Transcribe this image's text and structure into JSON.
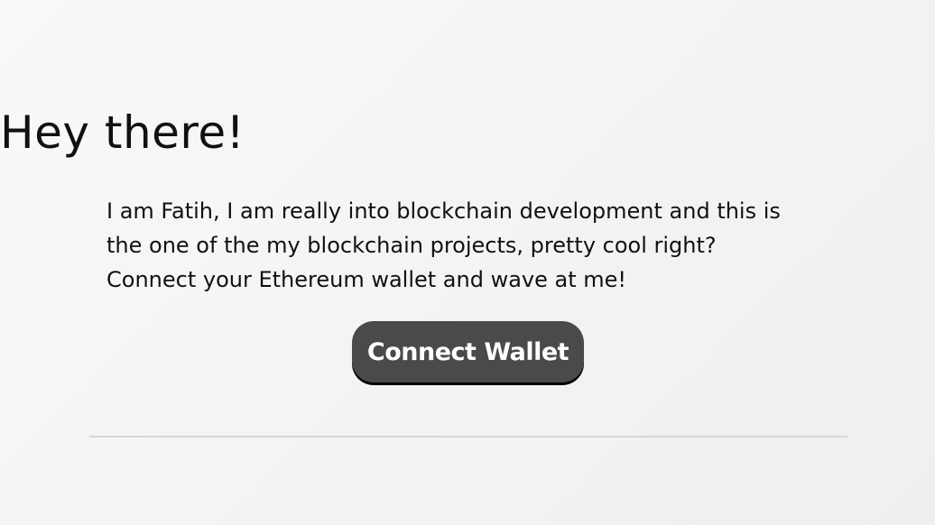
{
  "hero": {
    "title": "Hey there!",
    "bio_lines": [
      "I am Fatih, I am really into blockchain development and this is",
      "the one of the my blockchain projects, pretty cool right?",
      "Connect your Ethereum wallet and wave at me!"
    ],
    "connect_button_label": "Connect Wallet"
  },
  "colors": {
    "button_background": "#4a4a4a",
    "button_text": "#ffffff",
    "divider": "#d6d6d6"
  }
}
